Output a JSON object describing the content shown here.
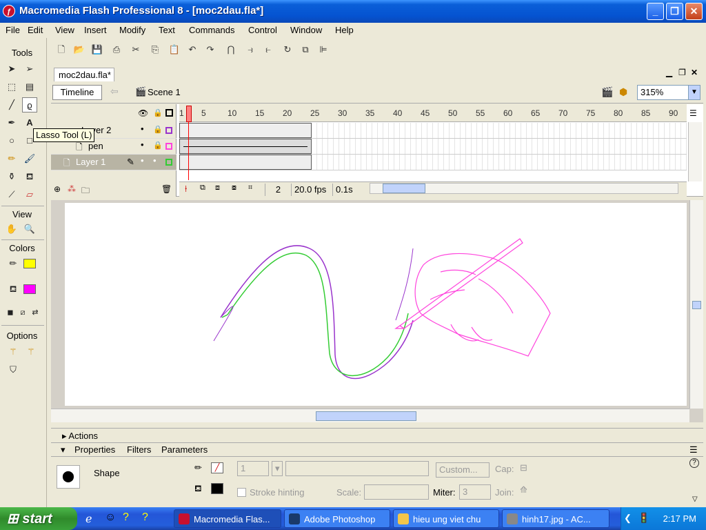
{
  "window": {
    "title": "Macromedia Flash Professional 8 - [moc2dau.fla*]"
  },
  "menu": [
    "File",
    "Edit",
    "View",
    "Insert",
    "Modify",
    "Text",
    "Commands",
    "Control",
    "Window",
    "Help"
  ],
  "tools": {
    "header": "Tools",
    "view_header": "View",
    "colors_header": "Colors",
    "options_header": "Options",
    "tooltip": "Lasso Tool (L)",
    "stroke_color": "#ffff00",
    "fill_color": "#ff00ff"
  },
  "document": {
    "tab": "moc2dau.fla*",
    "timeline_button": "Timeline",
    "scene": "Scene 1",
    "zoom": "315%"
  },
  "timeline": {
    "ruler": [
      "1",
      "5",
      "10",
      "15",
      "20",
      "25",
      "30",
      "35",
      "40",
      "45",
      "50",
      "55",
      "60",
      "65",
      "70",
      "75",
      "80",
      "85",
      "90"
    ],
    "layers": [
      {
        "name": "Layer 2"
      },
      {
        "name": "pen"
      },
      {
        "name": "Layer 1"
      }
    ],
    "current_frame": "2",
    "fps": "20.0 fps",
    "time": "0.1s"
  },
  "panels": {
    "actions": "Actions",
    "tabs": [
      "Properties",
      "Filters",
      "Parameters"
    ],
    "shape_label": "Shape",
    "stroke_value": "1",
    "custom_button": "Custom...",
    "cap_label": "Cap:",
    "stroke_hinting": "Stroke hinting",
    "scale_label": "Scale:",
    "miter_label": "Miter:",
    "miter_value": "3",
    "join_label": "Join:"
  },
  "taskbar": {
    "start": "start",
    "tasks": [
      "Macromedia Flas...",
      "Adobe Photoshop",
      "hieu ung viet chu",
      "hinh17.jpg - AC..."
    ],
    "clock": "2:17 PM"
  },
  "colors": {
    "pink": "#ff44dd",
    "green": "#33cc33",
    "purple": "#9933cc"
  }
}
